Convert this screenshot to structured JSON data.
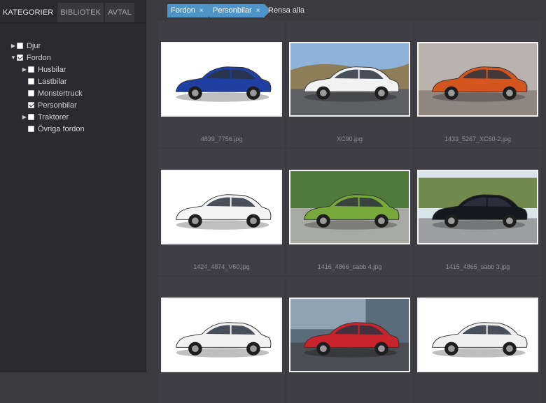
{
  "tabs": [
    "KATEGORIER",
    "BIBLIOTEK",
    "AVTAL"
  ],
  "tree": [
    {
      "label": "Djur",
      "checked": false,
      "caret": "right"
    },
    {
      "label": "Fordon",
      "checked": true,
      "caret": "down"
    },
    {
      "label": "Husbilar",
      "checked": false,
      "caret": "right"
    },
    {
      "label": "Lastbilar",
      "checked": false,
      "caret": ""
    },
    {
      "label": "Monstertruck",
      "checked": false,
      "caret": ""
    },
    {
      "label": "Personbilar",
      "checked": true,
      "caret": ""
    },
    {
      "label": "Traktorer",
      "checked": false,
      "caret": "right"
    },
    {
      "label": "Övriga fordon",
      "checked": false,
      "caret": ""
    }
  ],
  "filters": {
    "chips": [
      "Fordon",
      "Personbilar"
    ],
    "remove_glyph": "×",
    "clear_label": "Rensa alla"
  },
  "images": [
    {
      "filename": "4839_7756.jpg",
      "car_color": "#1f3fa3",
      "bg": "white"
    },
    {
      "filename": "XC90.jpg",
      "car_color": "#f2f2f2",
      "bg": "landscape"
    },
    {
      "filename": "1433_5267_XC60-2.jpg",
      "car_color": "#d4561e",
      "bg": "studio"
    },
    {
      "filename": "1424_4874_V60.jpg",
      "car_color": "#f4f4f4",
      "bg": "white"
    },
    {
      "filename": "1416_4866_sabb 4.jpg",
      "car_color": "#79a83a",
      "bg": "grass"
    },
    {
      "filename": "1415_4865_sabb 3.jpg",
      "car_color": "#15181d",
      "bg": "street"
    },
    {
      "filename": "",
      "car_color": "#f2f2f2",
      "bg": "white"
    },
    {
      "filename": "",
      "car_color": "#c9242c",
      "bg": "city"
    },
    {
      "filename": "",
      "car_color": "#f0f0f0",
      "bg": "white"
    }
  ],
  "colors": {
    "accent": "#4f94c7",
    "sidebar": "#2b2b2f",
    "main": "#3a3a3f"
  }
}
